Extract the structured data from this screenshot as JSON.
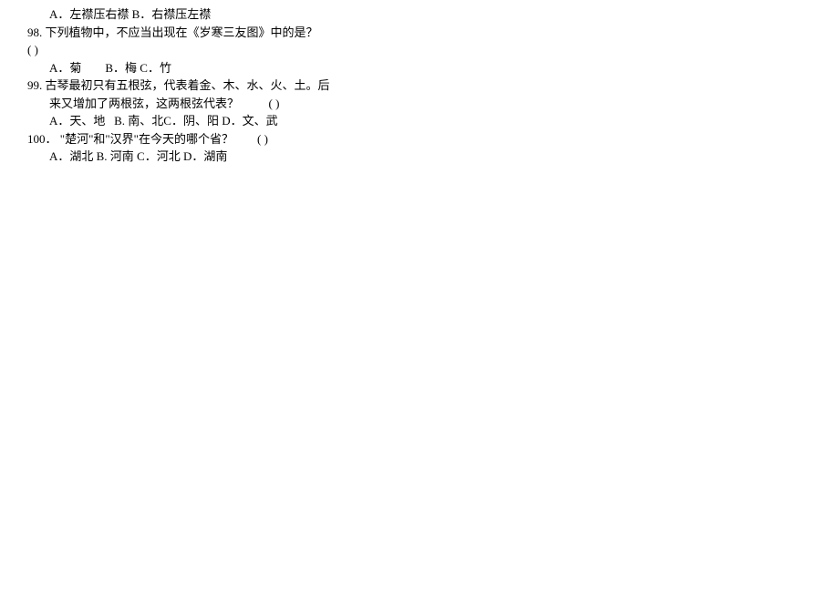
{
  "q97": {
    "options_line": "A．左襟压右襟 B．右襟压左襟"
  },
  "q98": {
    "num": "98.",
    "text": "下列植物中，不应当出现在《岁寒三友图》中的是？",
    "paren": "(  )",
    "options": "A．菊        B．梅 C．竹"
  },
  "q99": {
    "num": "99.",
    "text_part1": "古琴最初只有五根弦，代表着金、木、水、火、土。后",
    "text_part2": "来又增加了两根弦，这两根弦代表？          (  )",
    "options": "A．天、地   B. 南、北C．阴、阳 D．文、武"
  },
  "q100": {
    "num": "100．",
    "text": "\"楚河\"和\"汉界\"在今天的哪个省？        (  )",
    "options": "A．湖北 B. 河南 C．河北 D．湖南"
  }
}
